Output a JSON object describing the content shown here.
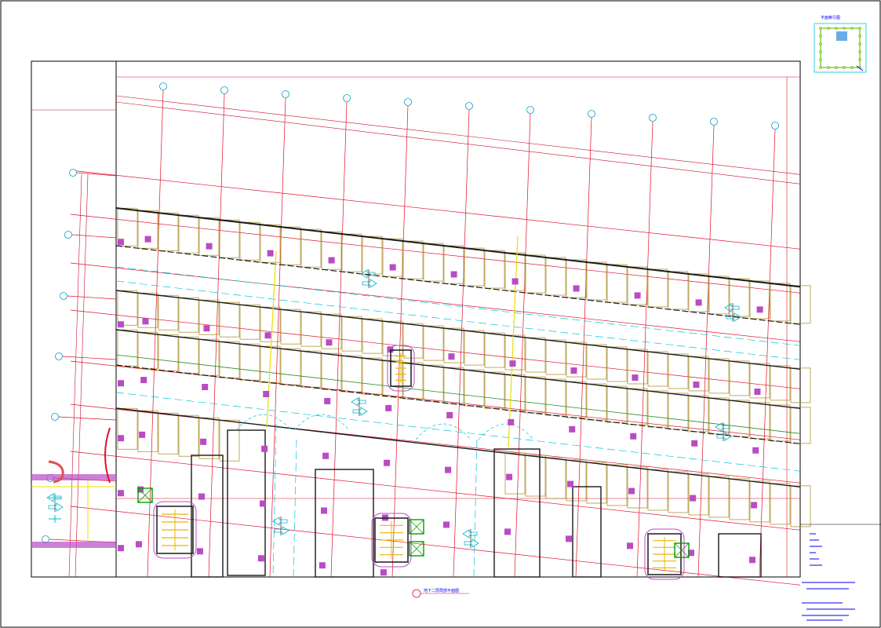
{
  "drawing": {
    "colors": {
      "paper": "#ffffff",
      "frame": "#000000",
      "grid_line": "#e0102a",
      "dim_line": "#c8102e",
      "parking_bay": "#a8861d",
      "column": "#b84cc4",
      "wall": "#1a1a1a",
      "aisle_line": "#00c8d8",
      "arrow": "#00b8d0",
      "ramp_line": "#e8e000",
      "stair": "#e8b800",
      "shaft": "#00a000",
      "annotation": "#0000ee"
    },
    "key_plan": {
      "label": "平面索引图"
    },
    "sheet_title": {
      "text": "地下二层局部平面图"
    },
    "icons": {
      "grid_bubble": "grid-axis-bubble-icon",
      "traffic_arrow": "two-way-traffic-arrow-icon",
      "stair": "stair-icon",
      "elevator": "elevator-shaft-icon",
      "north": "key-plan-icon"
    }
  }
}
